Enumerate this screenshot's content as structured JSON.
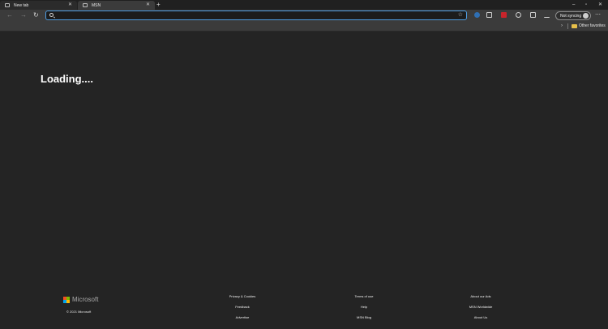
{
  "tabs": [
    {
      "label": "New tab"
    },
    {
      "label": "MSN"
    }
  ],
  "address_bar": {
    "value": "",
    "placeholder": ""
  },
  "profile": {
    "sync_label": "Not syncing"
  },
  "favorites_bar": {
    "other_favorites": "Other favorites"
  },
  "content": {
    "loading_text": "Loading...."
  },
  "footer": {
    "brand": "Microsoft",
    "copyright": "© 2021 Microsoft",
    "links": [
      [
        "Privacy & Cookies",
        "Feedback",
        "Advertise"
      ],
      [
        "Terms of use",
        "Help",
        "MSN Blog"
      ],
      [
        "About our Ads",
        "MSN Worldwide",
        "About Us"
      ]
    ]
  },
  "colors": {
    "page_bg": "#242424",
    "toolbar_bg": "#3b3b3b",
    "address_focus": "#4e9de2",
    "ms_red": "#f25022",
    "ms_green": "#7fba00",
    "ms_blue": "#00a4ef",
    "ms_yellow": "#ffb900"
  }
}
